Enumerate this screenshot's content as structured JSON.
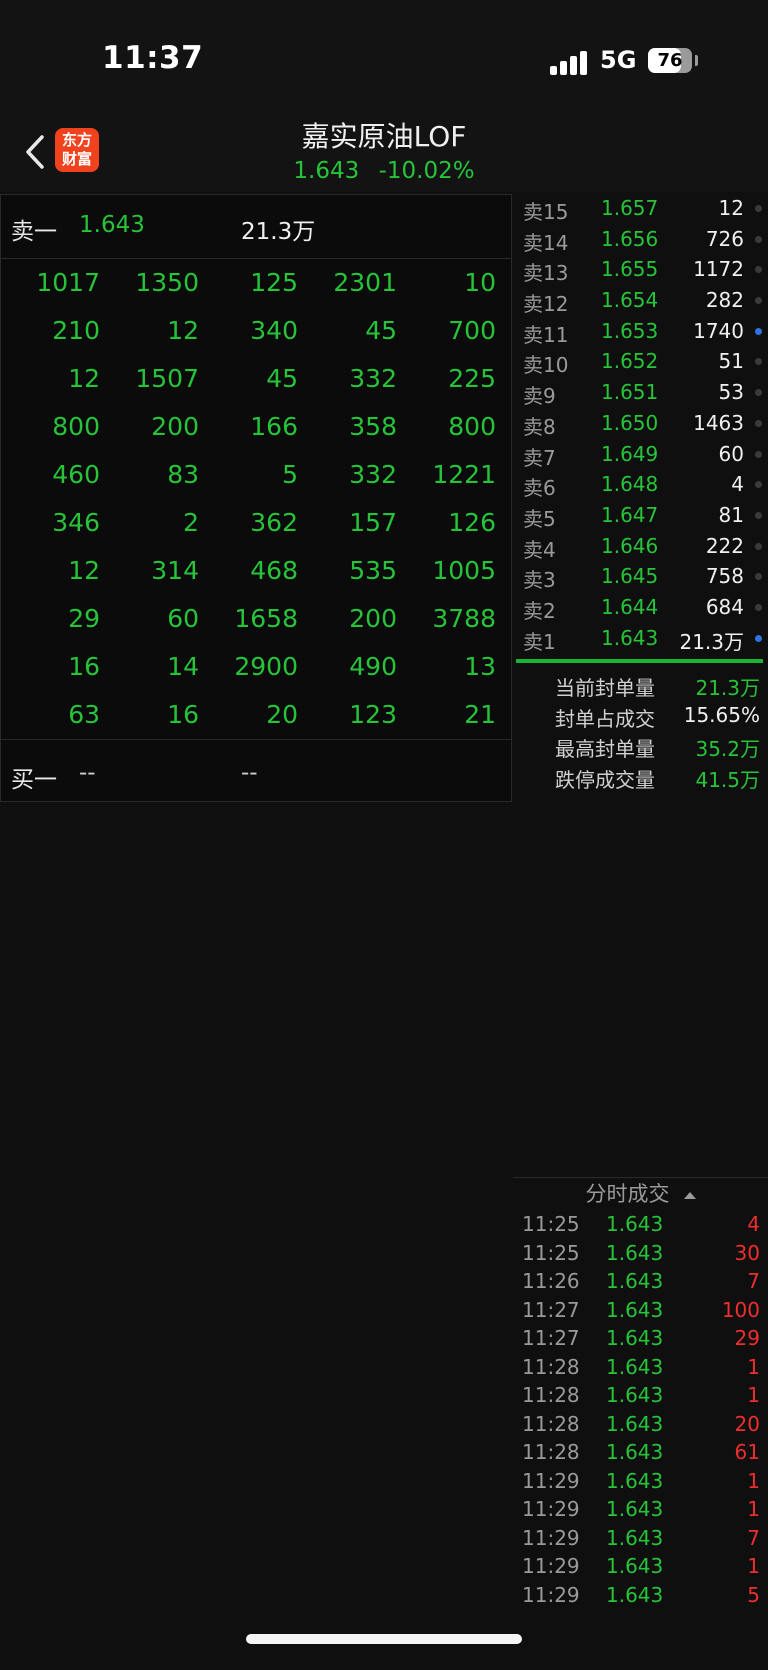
{
  "status_bar": {
    "time": "11:37",
    "network": "5G",
    "battery_level": 76,
    "battery_text": "76"
  },
  "header": {
    "title": "嘉实原油LOF",
    "price": "1.643",
    "change_pct": "-10.02%",
    "logo_line1": "东方",
    "logo_line2": "财富"
  },
  "left_panel": {
    "sell_one": {
      "label": "卖一",
      "price": "1.643",
      "volume": "21.3万"
    },
    "order_queue": [
      [
        "1017",
        "1350",
        "125",
        "2301",
        "10"
      ],
      [
        "210",
        "12",
        "340",
        "45",
        "700"
      ],
      [
        "12",
        "1507",
        "45",
        "332",
        "225"
      ],
      [
        "800",
        "200",
        "166",
        "358",
        "800"
      ],
      [
        "460",
        "83",
        "5",
        "332",
        "1221"
      ],
      [
        "346",
        "2",
        "362",
        "157",
        "126"
      ],
      [
        "12",
        "314",
        "468",
        "535",
        "1005"
      ],
      [
        "29",
        "60",
        "1658",
        "200",
        "3788"
      ],
      [
        "16",
        "14",
        "2900",
        "490",
        "13"
      ],
      [
        "63",
        "16",
        "20",
        "123",
        "21"
      ]
    ],
    "buy_one": {
      "label": "买一",
      "price": "--",
      "volume": "--"
    }
  },
  "ask_levels": [
    {
      "label": "卖15",
      "price": "1.657",
      "volume": "12",
      "dot": "gray"
    },
    {
      "label": "卖14",
      "price": "1.656",
      "volume": "726",
      "dot": "gray"
    },
    {
      "label": "卖13",
      "price": "1.655",
      "volume": "1172",
      "dot": "gray"
    },
    {
      "label": "卖12",
      "price": "1.654",
      "volume": "282",
      "dot": "gray"
    },
    {
      "label": "卖11",
      "price": "1.653",
      "volume": "1740",
      "dot": "blue"
    },
    {
      "label": "卖10",
      "price": "1.652",
      "volume": "51",
      "dot": "gray"
    },
    {
      "label": "卖9",
      "price": "1.651",
      "volume": "53",
      "dot": "gray"
    },
    {
      "label": "卖8",
      "price": "1.650",
      "volume": "1463",
      "dot": "gray"
    },
    {
      "label": "卖7",
      "price": "1.649",
      "volume": "60",
      "dot": "gray"
    },
    {
      "label": "卖6",
      "price": "1.648",
      "volume": "4",
      "dot": "gray"
    },
    {
      "label": "卖5",
      "price": "1.647",
      "volume": "81",
      "dot": "gray"
    },
    {
      "label": "卖4",
      "price": "1.646",
      "volume": "222",
      "dot": "gray"
    },
    {
      "label": "卖3",
      "price": "1.645",
      "volume": "758",
      "dot": "gray"
    },
    {
      "label": "卖2",
      "price": "1.644",
      "volume": "684",
      "dot": "gray"
    },
    {
      "label": "卖1",
      "price": "1.643",
      "volume": "21.3万",
      "dot": "blue"
    }
  ],
  "seal_stats": [
    {
      "label": "当前封单量",
      "value": "21.3万",
      "color": "green"
    },
    {
      "label": "封单占成交",
      "value": "15.65%",
      "color": "white"
    },
    {
      "label": "最高封单量",
      "value": "35.2万",
      "color": "green"
    },
    {
      "label": "跌停成交量",
      "value": "41.5万",
      "color": "green"
    }
  ],
  "trades": {
    "header": "分时成交",
    "rows": [
      {
        "time": "11:25",
        "price": "1.643",
        "volume": "4"
      },
      {
        "time": "11:25",
        "price": "1.643",
        "volume": "30"
      },
      {
        "time": "11:26",
        "price": "1.643",
        "volume": "7"
      },
      {
        "time": "11:27",
        "price": "1.643",
        "volume": "100"
      },
      {
        "time": "11:27",
        "price": "1.643",
        "volume": "29"
      },
      {
        "time": "11:28",
        "price": "1.643",
        "volume": "1"
      },
      {
        "time": "11:28",
        "price": "1.643",
        "volume": "1"
      },
      {
        "time": "11:28",
        "price": "1.643",
        "volume": "20"
      },
      {
        "time": "11:28",
        "price": "1.643",
        "volume": "61"
      },
      {
        "time": "11:29",
        "price": "1.643",
        "volume": "1"
      },
      {
        "time": "11:29",
        "price": "1.643",
        "volume": "1"
      },
      {
        "time": "11:29",
        "price": "1.643",
        "volume": "7"
      },
      {
        "time": "11:29",
        "price": "1.643",
        "volume": "1"
      },
      {
        "time": "11:29",
        "price": "1.643",
        "volume": "5"
      }
    ]
  },
  "colors": {
    "green": "#27c43a",
    "red": "#ee2e2e",
    "blue_dot": "#2e74e0",
    "logo": "#f0421c"
  }
}
